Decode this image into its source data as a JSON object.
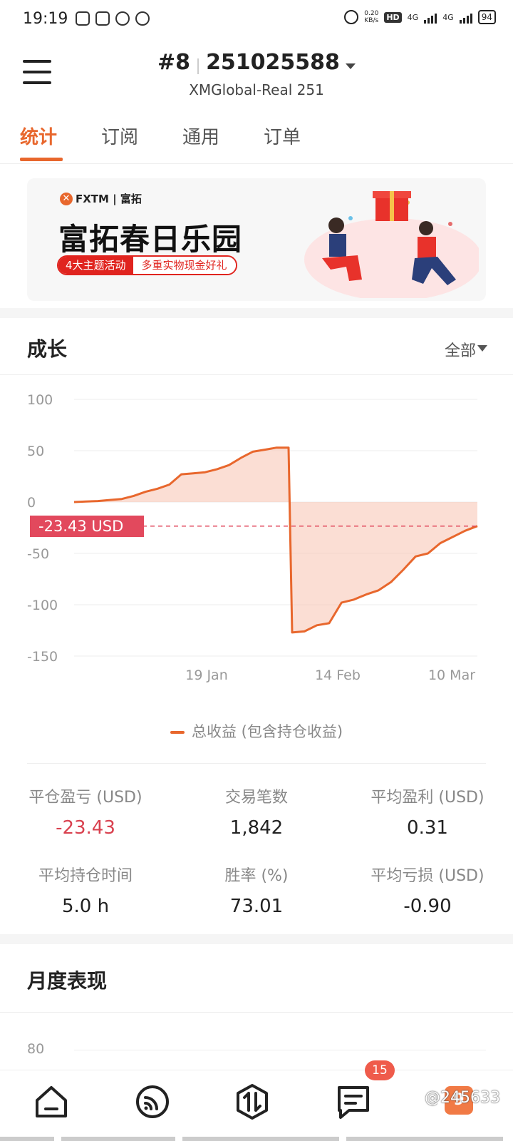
{
  "status_bar": {
    "time": "19:19",
    "net_speed_value": "0.20",
    "net_speed_unit": "KB/s",
    "hd": "HD",
    "sim1": "4G",
    "sim2": "4G",
    "battery": "94"
  },
  "header": {
    "account_number": "#8",
    "account_id": "251025588",
    "server": "XMGlobal-Real 251"
  },
  "tabs": [
    {
      "label": "统计",
      "active": true
    },
    {
      "label": "订阅",
      "active": false
    },
    {
      "label": "通用",
      "active": false
    },
    {
      "label": "订单",
      "active": false
    }
  ],
  "banner": {
    "brand": "FXTM | 富拓",
    "title": "富拓春日乐园",
    "tag_left": "4大主题活动",
    "tag_right": "多重实物现金好礼"
  },
  "growth": {
    "title": "成长",
    "range": "全部",
    "current_badge": "-23.43  USD",
    "legend": "总收益 (包含持仓收益)"
  },
  "chart_data": {
    "type": "area",
    "yticks": [
      "100",
      "50",
      "0",
      "-50",
      "-100",
      "-150"
    ],
    "xticks": [
      "19 Jan",
      "14 Feb",
      "10 Mar"
    ],
    "ylim": [
      -150,
      100
    ],
    "current_value": -23.43,
    "series": [
      {
        "name": "总收益 (包含持仓收益)",
        "values": [
          0,
          0.5,
          1,
          2,
          3,
          6,
          10,
          13,
          17,
          27,
          28,
          29,
          32,
          36,
          43,
          49,
          51,
          53,
          53,
          -127,
          -126,
          -120,
          -118,
          -98,
          -95,
          -90,
          -86,
          -78,
          -66,
          -53,
          -50,
          -40,
          -34,
          -28,
          -23.43
        ]
      }
    ],
    "colors": {
      "line": "#e8672d",
      "fill": "#f7c3b1",
      "badge": "#e2495d"
    }
  },
  "stats": [
    {
      "label": "平仓盈亏 (USD)",
      "value": "-23.43",
      "negative": true
    },
    {
      "label": "交易笔数",
      "value": "1,842",
      "negative": false
    },
    {
      "label": "平均盈利 (USD)",
      "value": "0.31",
      "negative": false
    },
    {
      "label": "平均持仓时间",
      "value": "5.0 h",
      "negative": false
    },
    {
      "label": "胜率 (%)",
      "value": "73.01",
      "negative": false
    },
    {
      "label": "平均亏损 (USD)",
      "value": "-0.90",
      "negative": false
    }
  ],
  "monthly": {
    "title": "月度表现",
    "first_tick": "80"
  },
  "bottom_nav": {
    "items": [
      "home-icon",
      "signal-icon",
      "trade-icon",
      "messages-icon",
      "profile-icon"
    ],
    "messages_badge": "15",
    "last_icon_text": "9",
    "watermark": "@245633"
  }
}
